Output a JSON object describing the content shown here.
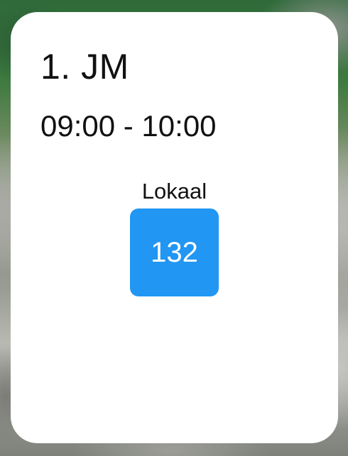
{
  "lesson": {
    "class_name": "1. JM",
    "time_range": "09:00 - 10:00",
    "room_label": "Lokaal",
    "room_number": "132"
  },
  "colors": {
    "card_background": "#ffffff",
    "room_badge": "#2196f3",
    "text": "#111111",
    "badge_text": "#ffffff"
  }
}
